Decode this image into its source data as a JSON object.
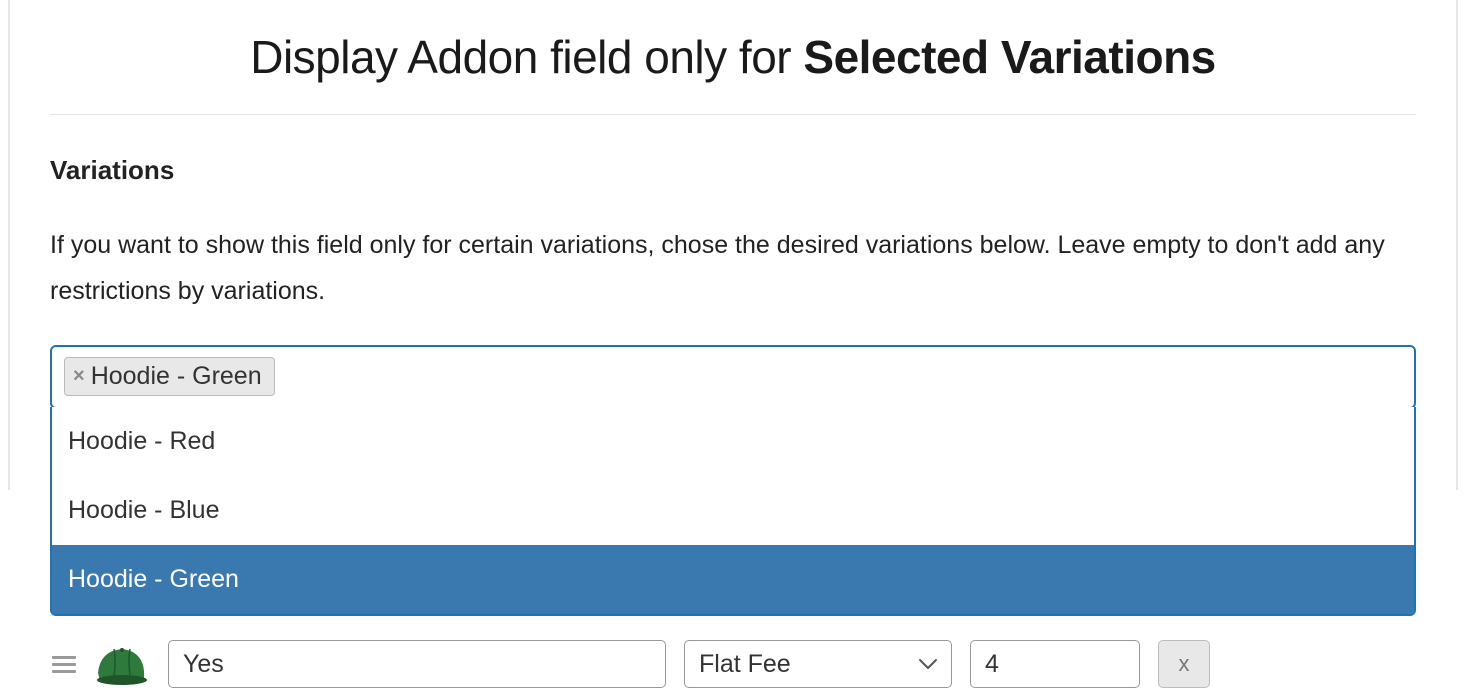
{
  "header": {
    "title_prefix": "Display Addon field only for ",
    "title_strong": "Selected Variations"
  },
  "variations": {
    "label": "Variations",
    "description": "If you want to show this field only for certain variations, chose the desired variations below. Leave empty to don't add any restrictions by variations.",
    "selected_tag": "Hoodie - Green",
    "options": [
      {
        "label": "Hoodie - Red",
        "highlighted": false
      },
      {
        "label": "Hoodie - Blue",
        "highlighted": false
      },
      {
        "label": "Hoodie - Green",
        "highlighted": true
      }
    ]
  },
  "row": {
    "yes_value": "Yes",
    "fee_type": "Flat Fee",
    "amount": "4",
    "remove_label": "x"
  },
  "colors": {
    "accent": "#2271b1",
    "highlight": "#3a78b0",
    "cap_green": "#2d7a3c",
    "cap_green_dark": "#1f5529"
  }
}
